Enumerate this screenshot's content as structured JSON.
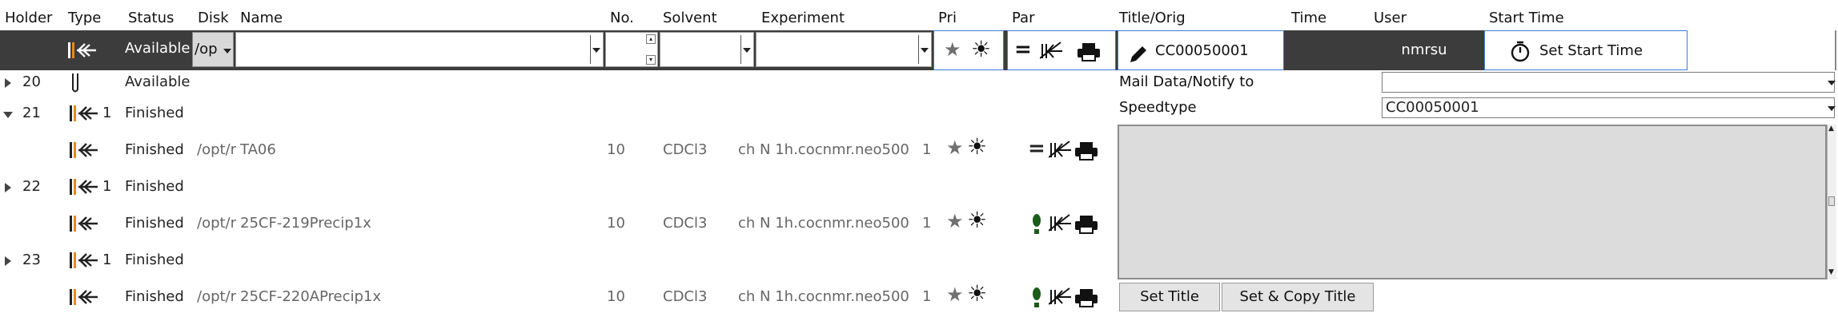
{
  "headers": {
    "holder": "Holder",
    "type": "Type",
    "status": "Status",
    "disk": "Disk",
    "name": "Name",
    "no": "No.",
    "solvent": "Solvent",
    "experiment": "Experiment",
    "pri": "Pri",
    "par": "Par",
    "title_orig": "Title/Orig",
    "time": "Time",
    "user": "User",
    "start_time": "Start Time"
  },
  "toolbar": {
    "status": "Available",
    "disk": "/op",
    "title_orig": "CC00050001",
    "user": "nmrsu",
    "start_time_button": "Set Start Time"
  },
  "rows": [
    {
      "holder": "20",
      "expander": "collapsed",
      "count": "",
      "status": "Available",
      "disk": "",
      "name": "",
      "no": "",
      "solvent": "",
      "experiment": "",
      "pri": "",
      "type_icon": "tube-icon"
    },
    {
      "holder": "21",
      "expander": "expanded",
      "count": "1",
      "status": "Finished",
      "disk": "",
      "name": "",
      "no": "",
      "solvent": "",
      "experiment": "",
      "pri": "",
      "type_icon": "holder-icon"
    },
    {
      "holder": "",
      "expander": "",
      "count": "",
      "status": "Finished",
      "disk": "/opt/r",
      "name": "TA06",
      "no": "10",
      "solvent": "CDCl3",
      "experiment": "ch  N 1h.cocnmr.neo500",
      "pri": "1",
      "type_icon": "holder-icon",
      "par_icon": "equals-icon"
    },
    {
      "holder": "22",
      "expander": "collapsed",
      "count": "1",
      "status": "Finished",
      "disk": "",
      "name": "",
      "no": "",
      "solvent": "",
      "experiment": "",
      "pri": "",
      "type_icon": "holder-icon"
    },
    {
      "holder": "",
      "expander": "",
      "count": "",
      "status": "Finished",
      "disk": "/opt/r",
      "name": "25CF-219Precip1x",
      "no": "10",
      "solvent": "CDCl3",
      "experiment": "ch  N 1h.cocnmr.neo500",
      "pri": "1",
      "type_icon": "holder-icon",
      "par_icon": "exclamation-icon"
    },
    {
      "holder": "23",
      "expander": "collapsed",
      "count": "1",
      "status": "Finished",
      "disk": "",
      "name": "",
      "no": "",
      "solvent": "",
      "experiment": "",
      "pri": "",
      "type_icon": "holder-icon"
    },
    {
      "holder": "",
      "expander": "",
      "count": "",
      "status": "Finished",
      "disk": "/opt/r",
      "name": "25CF-220APrecip1x",
      "no": "10",
      "solvent": "CDCl3",
      "experiment": "ch  N 1h.cocnmr.neo500",
      "pri": "1",
      "type_icon": "holder-icon",
      "par_icon": "exclamation-icon"
    }
  ],
  "side_panel": {
    "mail_label": "Mail Data/Notify to",
    "mail_value": "",
    "speedtype_label": "Speedtype",
    "speedtype_value": "CC00050001",
    "set_title_button": "Set Title",
    "set_copy_title_button": "Set & Copy Title"
  },
  "colors": {
    "toolbar_bg": "#3c3c3c",
    "holder_orange": "#e8891a",
    "exclamation_green": "#1a5c1a",
    "panel_gray": "#dcdcdc",
    "focus_blue": "#3a7bd5"
  }
}
